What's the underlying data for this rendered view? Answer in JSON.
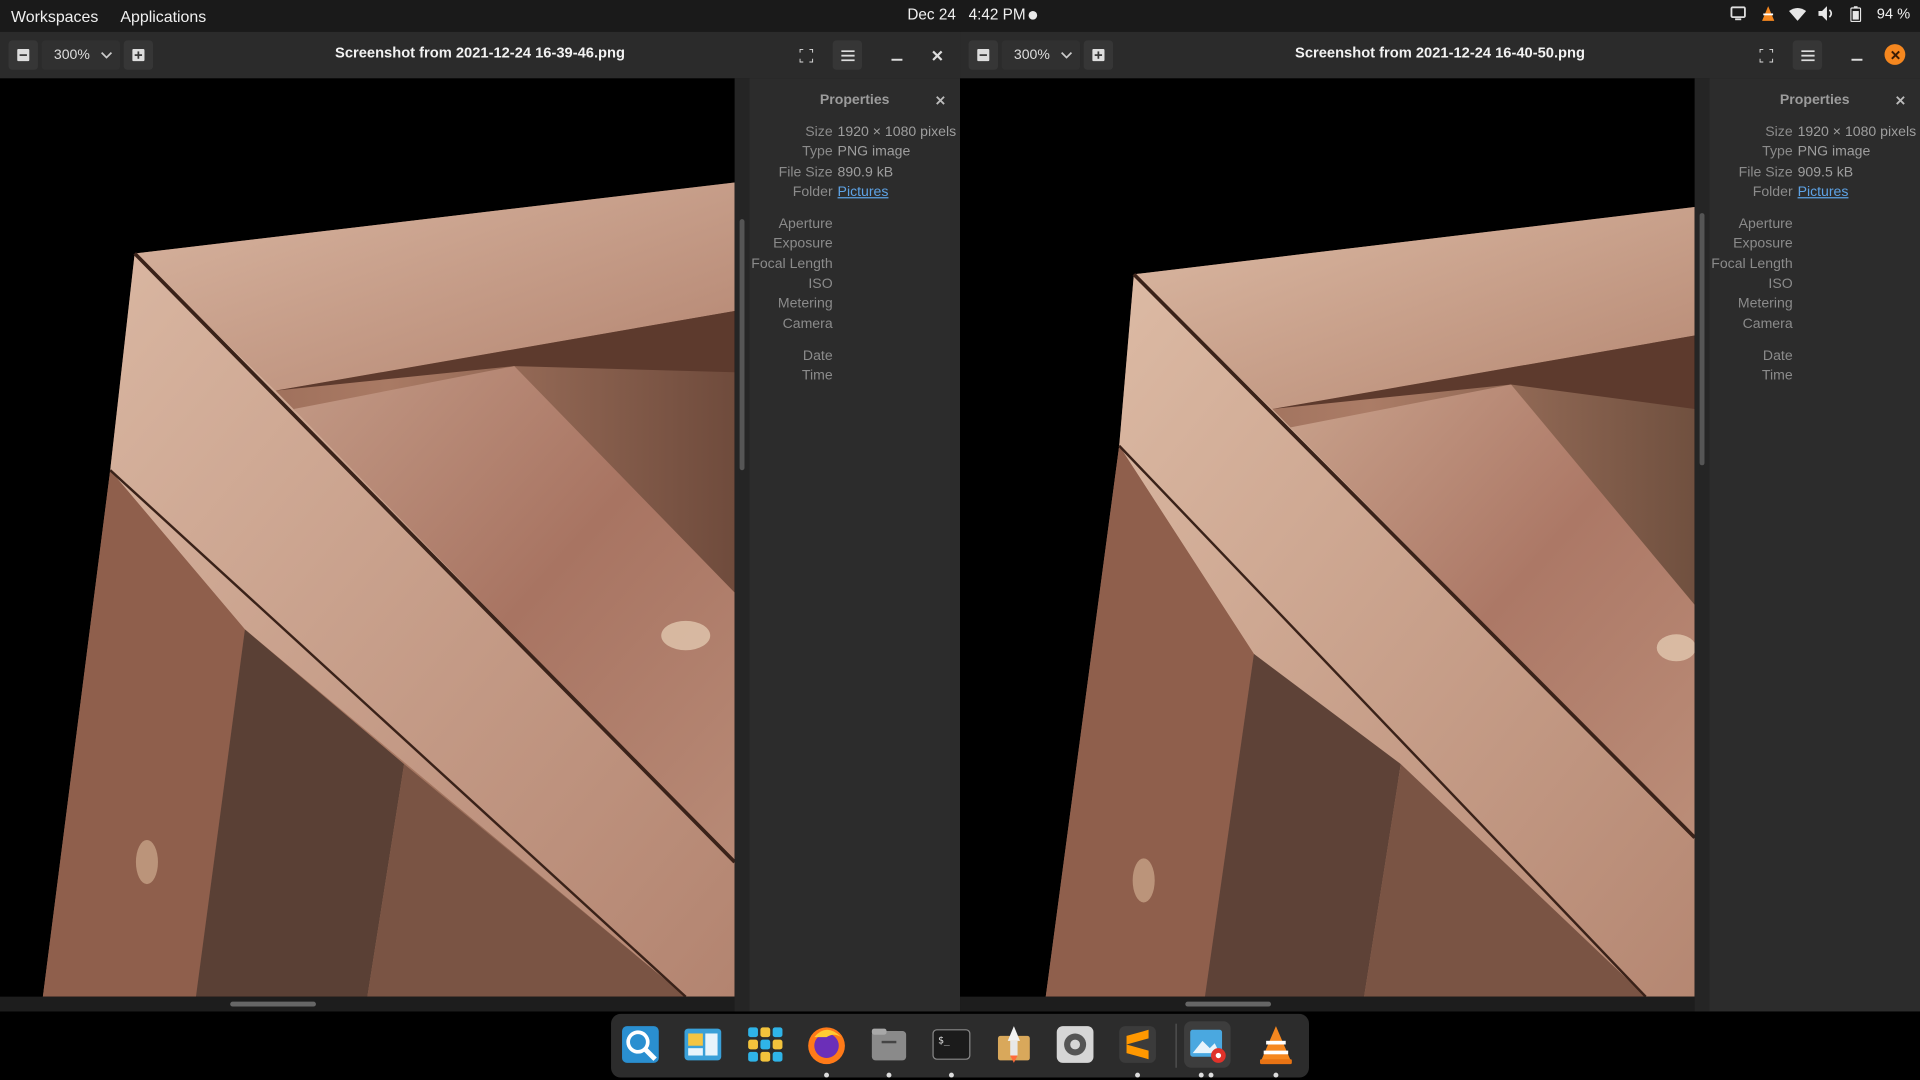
{
  "topbar": {
    "workspaces": "Workspaces",
    "applications": "Applications",
    "date": "Dec 24",
    "time": "4:42 PM",
    "battery": "94 %"
  },
  "left": {
    "zoom": "300%",
    "title": "Screenshot from 2021-12-24 16-39-46.png",
    "props": {
      "title": "Properties",
      "size": "1920 × 1080 pixels",
      "type": "PNG image",
      "file_size": "890.9 kB",
      "folder": "Pictures"
    }
  },
  "right": {
    "zoom": "300%",
    "title": "Screenshot from 2021-12-24 16-40-50.png",
    "props": {
      "title": "Properties",
      "size": "1920 × 1080 pixels",
      "type": "PNG image",
      "file_size": "909.5 kB",
      "folder": "Pictures"
    }
  },
  "labels": {
    "size": "Size",
    "type": "Type",
    "file_size": "File Size",
    "folder": "Folder",
    "aperture": "Aperture",
    "exposure": "Exposure",
    "focal_length": "Focal Length",
    "iso": "ISO",
    "metering": "Metering",
    "camera": "Camera",
    "date": "Date",
    "time": "Time"
  },
  "colors": {
    "accent_close": "#f5871f",
    "link": "#5ea3e6",
    "panel": "#2c2c2c",
    "header": "#2b2b2b"
  },
  "dock": {
    "apps": [
      "search-app-icon",
      "window-switcher-icon",
      "app-grid-icon",
      "firefox-icon",
      "files-icon",
      "terminal-icon",
      "rocket-app-icon",
      "settings-icon",
      "sublime-icon",
      "image-viewer-icon",
      "vlc-icon"
    ]
  }
}
